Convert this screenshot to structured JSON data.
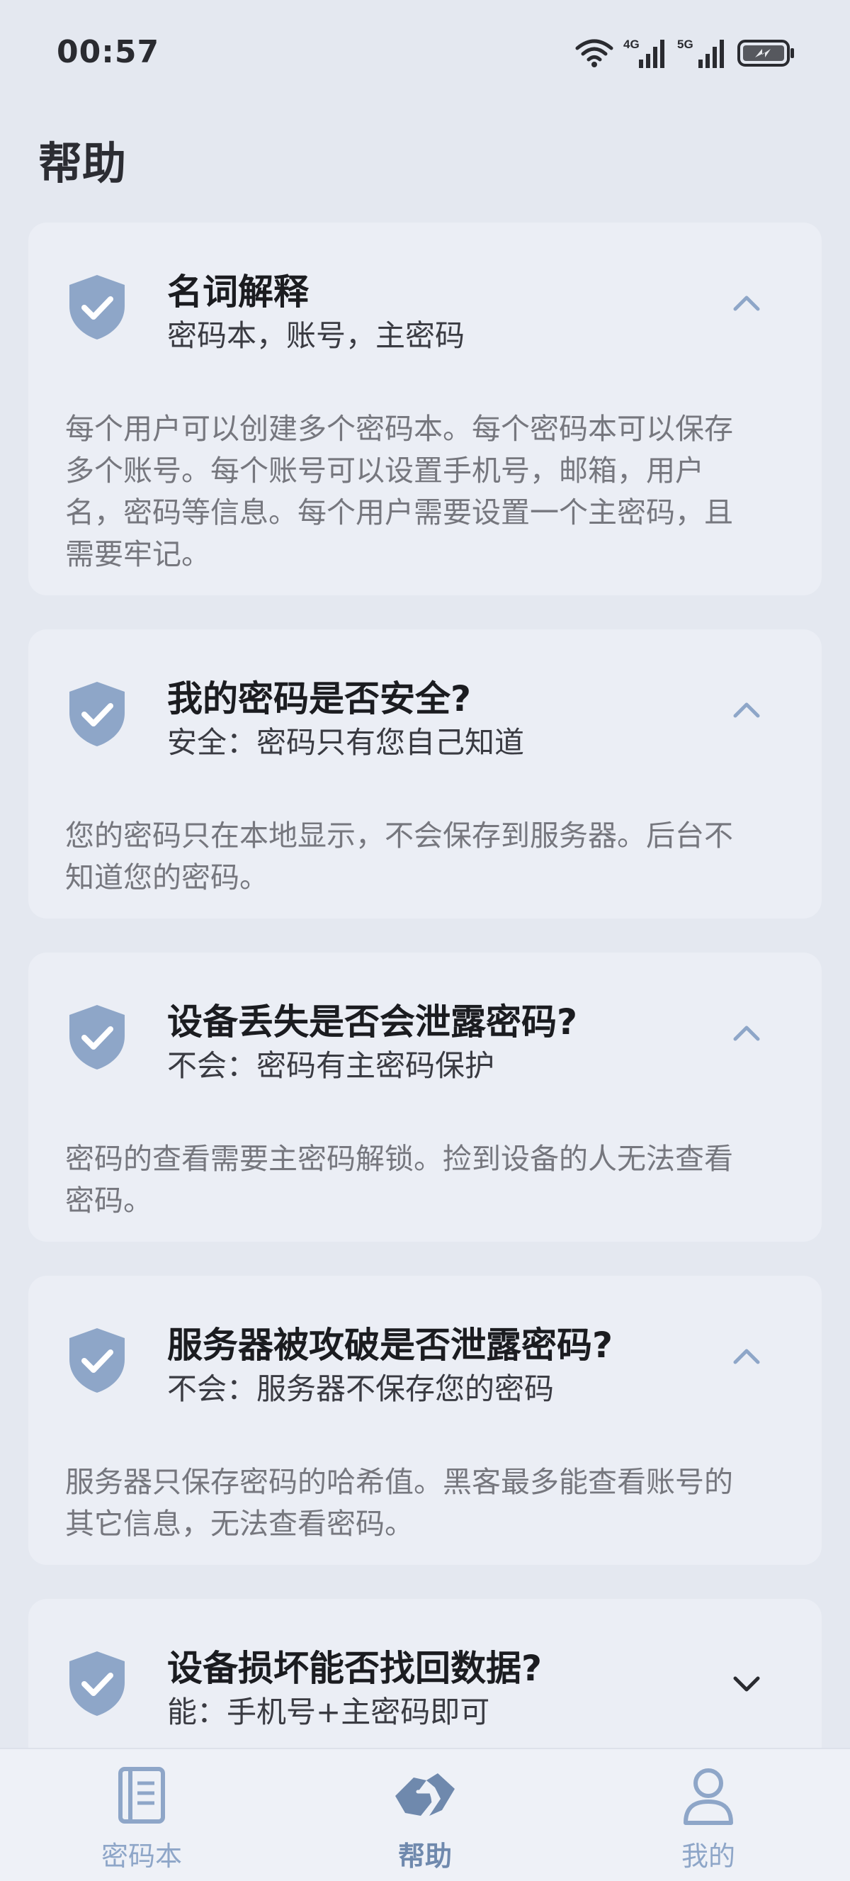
{
  "status": {
    "time": "00:57",
    "net1": "4G",
    "net2": "5G"
  },
  "page": {
    "title": "帮助"
  },
  "faq": [
    {
      "title": "名词解释",
      "subtitle": "密码本，账号，主密码",
      "body": "每个用户可以创建多个密码本。每个密码本可以保存多个账号。每个账号可以设置手机号，邮箱，用户名，密码等信息。每个用户需要设置一个主密码，且需要牢记。",
      "expanded": true
    },
    {
      "title": "我的密码是否安全?",
      "subtitle": "安全：密码只有您自己知道",
      "body": "您的密码只在本地显示，不会保存到服务器。后台不知道您的密码。",
      "expanded": true
    },
    {
      "title": "设备丢失是否会泄露密码?",
      "subtitle": "不会：密码有主密码保护",
      "body": "密码的查看需要主密码解锁。捡到设备的人无法查看密码。",
      "expanded": true
    },
    {
      "title": "服务器被攻破是否泄露密码?",
      "subtitle": "不会：服务器不保存您的密码",
      "body": "服务器只保存密码的哈希值。黑客最多能查看账号的其它信息，无法查看密码。",
      "expanded": true
    },
    {
      "title": "设备损坏能否找回数据?",
      "subtitle": "能：手机号+主密码即可",
      "expanded": false
    }
  ],
  "nav": {
    "items": [
      {
        "label": "密码本",
        "icon": "notebook-icon",
        "active": false
      },
      {
        "label": "帮助",
        "icon": "handshake-icon",
        "active": true
      },
      {
        "label": "我的",
        "icon": "person-icon",
        "active": false
      }
    ]
  },
  "colors": {
    "background": "#e4e8f0",
    "card": "#ebeef5",
    "accent": "#8ea6c8",
    "accent_dark": "#6f89ad"
  }
}
